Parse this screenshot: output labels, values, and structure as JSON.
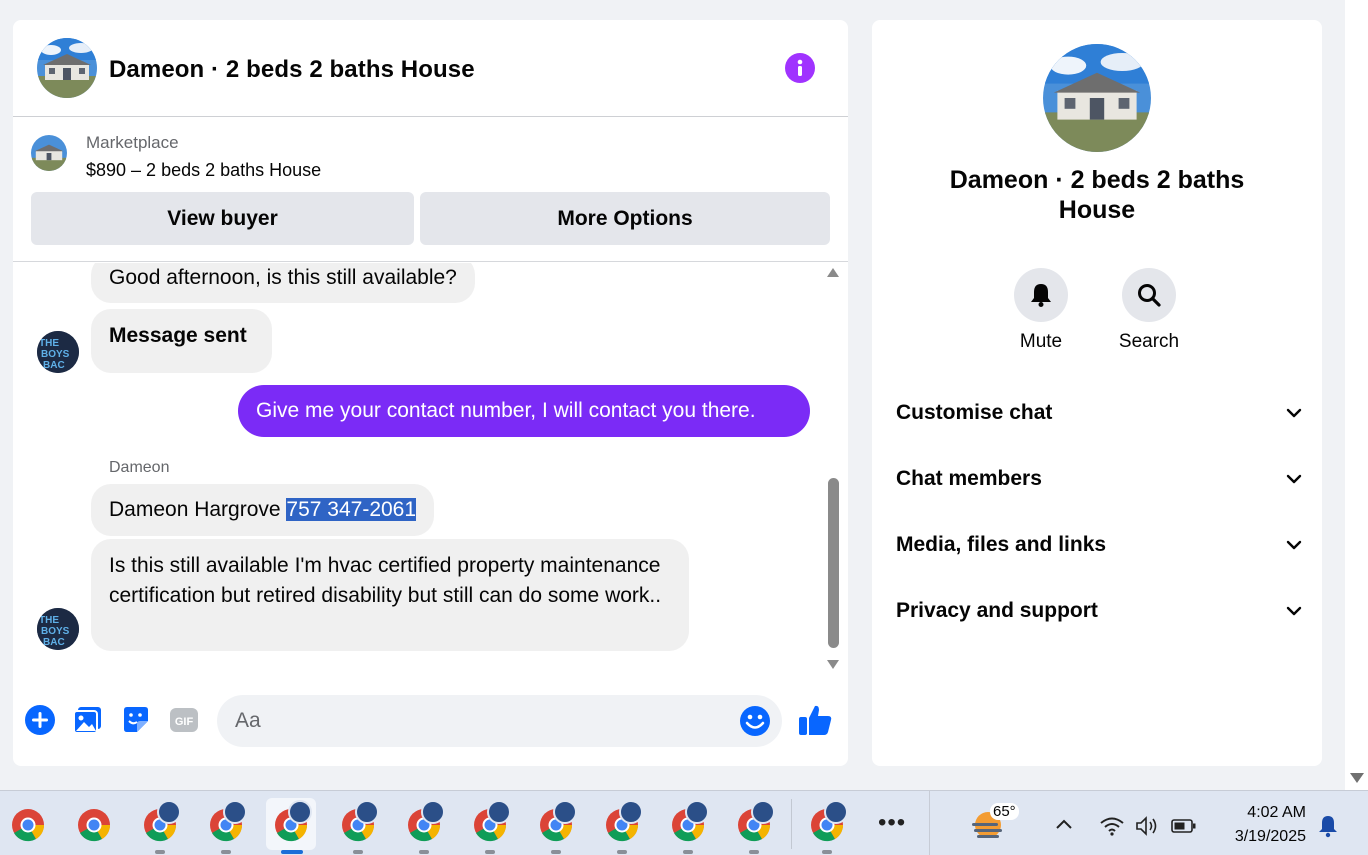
{
  "chat": {
    "title": "Dameon · 2 beds 2 baths House",
    "listing": {
      "category": "Marketplace",
      "title": "$890 – 2 beds 2 baths House",
      "view_buyer_label": "View buyer",
      "more_options_label": "More Options"
    },
    "messages": [
      {
        "side": "in",
        "text": "Good afternoon, is this still available?"
      },
      {
        "side": "in",
        "text": "Message sent"
      },
      {
        "side": "out",
        "text": "Give me your contact number, I will contact you there."
      },
      {
        "side": "in",
        "sender": "Dameon",
        "text_prefix": "Dameon Hargrove ",
        "text_highlight": "757 347-2061"
      },
      {
        "side": "in",
        "text": "Is this still available I'm hvac certified property maintenance certification but retired disability but still can do some work.."
      }
    ],
    "composer": {
      "placeholder": "Aa"
    },
    "accent_color": "#7b2bf6"
  },
  "info_panel": {
    "title": "Dameon · 2 beds 2 baths House",
    "actions": [
      {
        "label": "Mute",
        "icon": "bell-icon"
      },
      {
        "label": "Search",
        "icon": "search-icon"
      }
    ],
    "sections": [
      "Customise chat",
      "Chat members",
      "Media, files and links",
      "Privacy and support"
    ]
  },
  "taskbar": {
    "weather_temp": "65°",
    "time": "4:02 AM",
    "date": "3/19/2025"
  }
}
